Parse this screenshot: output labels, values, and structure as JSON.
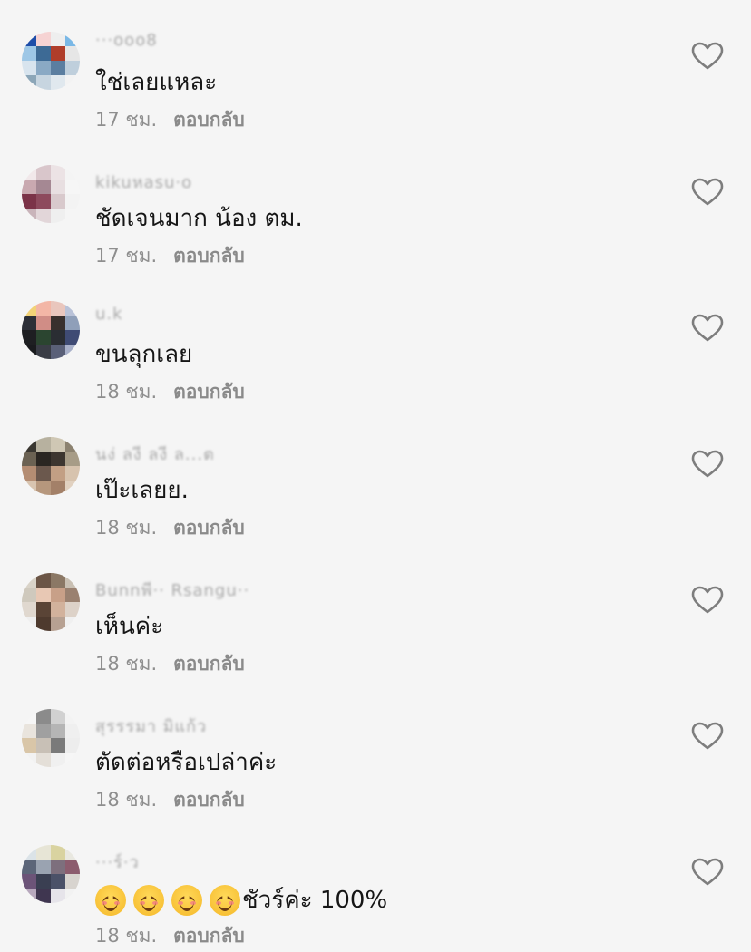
{
  "comments": [
    {
      "username": "···ooo8",
      "text": "ใช่เลยแหละ",
      "time": "17 ชม.",
      "reply": "ตอบกลับ",
      "avatar": [
        "#1e4da8",
        "#f6d3d3",
        "#eeeeee",
        "#7ab8e6",
        "#9ec7e6",
        "#3d6a95",
        "#b03d2a",
        "#e6e6e6",
        "#d8e4ee",
        "#8aa9c4",
        "#5b7ea0",
        "#bfcfdc",
        "#8ca6b8",
        "#c7d5e0",
        "#e0e8ee",
        "#f3f3f3"
      ]
    },
    {
      "username": "kikuหasu·o",
      "text": "ชัดเจนมาก น้อง ตม.",
      "time": "17 ชม.",
      "reply": "ตอบกลับ",
      "avatar": [
        "#f1e8ea",
        "#d9c6cb",
        "#ece3e5",
        "#f4f4f4",
        "#c9a9b0",
        "#a58893",
        "#e8dfe1",
        "#f6f6f6",
        "#7b3348",
        "#8d4a5d",
        "#d8c9cc",
        "#f3f3f3",
        "#c9b4ba",
        "#e2d6d9",
        "#efefef",
        "#f5f5f5"
      ]
    },
    {
      "username": "u.k",
      "text": "ขนลุกเลย",
      "time": "18 ชม.",
      "reply": "ตอบกลับ",
      "avatar": [
        "#f2d277",
        "#f3b6a6",
        "#e9c6bd",
        "#b9c2d8",
        "#2c2f37",
        "#d08d86",
        "#39302d",
        "#8f9fb9",
        "#1e1f22",
        "#2b4530",
        "#2a2d33",
        "#3f4b74",
        "#1a1b1e",
        "#3a3d46",
        "#5a6078",
        "#a8b0c9"
      ]
    },
    {
      "username": "นง่ ลงี ลงี ล...ต",
      "text": "เป๊ะเลยย.",
      "time": "18 ชม.",
      "reply": "ตอบกลับ",
      "avatar": [
        "#3a3731",
        "#b7b19f",
        "#cfc7b4",
        "#8c8270",
        "#6b6253",
        "#2a2622",
        "#3d3630",
        "#a79c87",
        "#b48d73",
        "#6b584d",
        "#c29f84",
        "#d7c3ae",
        "#d8c4b0",
        "#b6977d",
        "#a38068",
        "#e1d1c0"
      ]
    },
    {
      "username": "Bunnพี·· Rsangu··",
      "text": "เห็นค่ะ",
      "time": "18 ชม.",
      "reply": "ตอบกลับ",
      "avatar": [
        "#d9d3c8",
        "#6b5546",
        "#8b7865",
        "#c9c0b3",
        "#cfc9bd",
        "#e8c8b4",
        "#c8a088",
        "#9a8170",
        "#e0d8cf",
        "#5a4436",
        "#d2b29c",
        "#ddd2c8",
        "#efefef",
        "#4e3a2e",
        "#b7a192",
        "#f0f0f0"
      ]
    },
    {
      "username": "สุรรรมา มิแก้ว",
      "text": "ตัดต่อหรือเปล่าค่ะ",
      "time": "18 ชม.",
      "reply": "ตอบกลับ",
      "avatar": [
        "#f6f6f6",
        "#8b8b8b",
        "#d1d1d1",
        "#f3f3f3",
        "#e9e4dd",
        "#a0a0a0",
        "#b5b5b5",
        "#efefef",
        "#d9c6a8",
        "#c8c0b6",
        "#7a7a7a",
        "#ededed",
        "#f2f2f2",
        "#e4dfd8",
        "#f0f0f0",
        "#f6f6f6"
      ]
    },
    {
      "username": "···ร์·ว",
      "text": "ชัวร์ค่ะ 100%",
      "time": "18 ชม.",
      "reply": "ตอบกลับ",
      "avatar": [
        "#dbe3e8",
        "#e7e5d6",
        "#d9d3a0",
        "#e9e8e0",
        "#5c6679",
        "#9aa3b1",
        "#7d6f7d",
        "#8c5c6e",
        "#6c5478",
        "#3a3f52",
        "#4b5168",
        "#d8d4cf",
        "#b7a8bd",
        "#3f3650",
        "#e6e4ea",
        "#f2f2f2"
      ]
    }
  ],
  "emoji_count": 4,
  "emoji_name": "smiling-face-with-smiling-eyes",
  "heart_icon": "heart-outline-icon"
}
